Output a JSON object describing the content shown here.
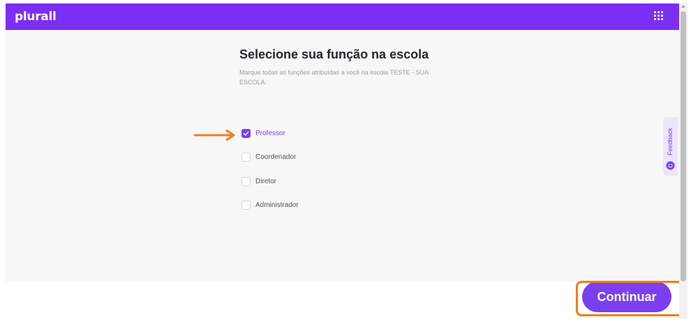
{
  "header": {
    "logo_text": "plurall",
    "brand_color": "#7b2ff2",
    "apps_icon": "grid-dots-icon"
  },
  "main": {
    "title": "Selecione sua função na escola",
    "subtitle": "Marque todas as funções atribuídas a você na escola TESTE - SUA ESCOLA.",
    "roles": [
      {
        "label": "Professor",
        "checked": true
      },
      {
        "label": "Coordenador",
        "checked": false
      },
      {
        "label": "Diretor",
        "checked": false
      },
      {
        "label": "Administrador",
        "checked": false
      }
    ]
  },
  "feedback": {
    "label": "Feedback",
    "icon": "smile-icon"
  },
  "footer": {
    "continue_label": "Continuar"
  },
  "colors": {
    "accent": "#7b3ff0",
    "annotation": "#f07d1a"
  }
}
